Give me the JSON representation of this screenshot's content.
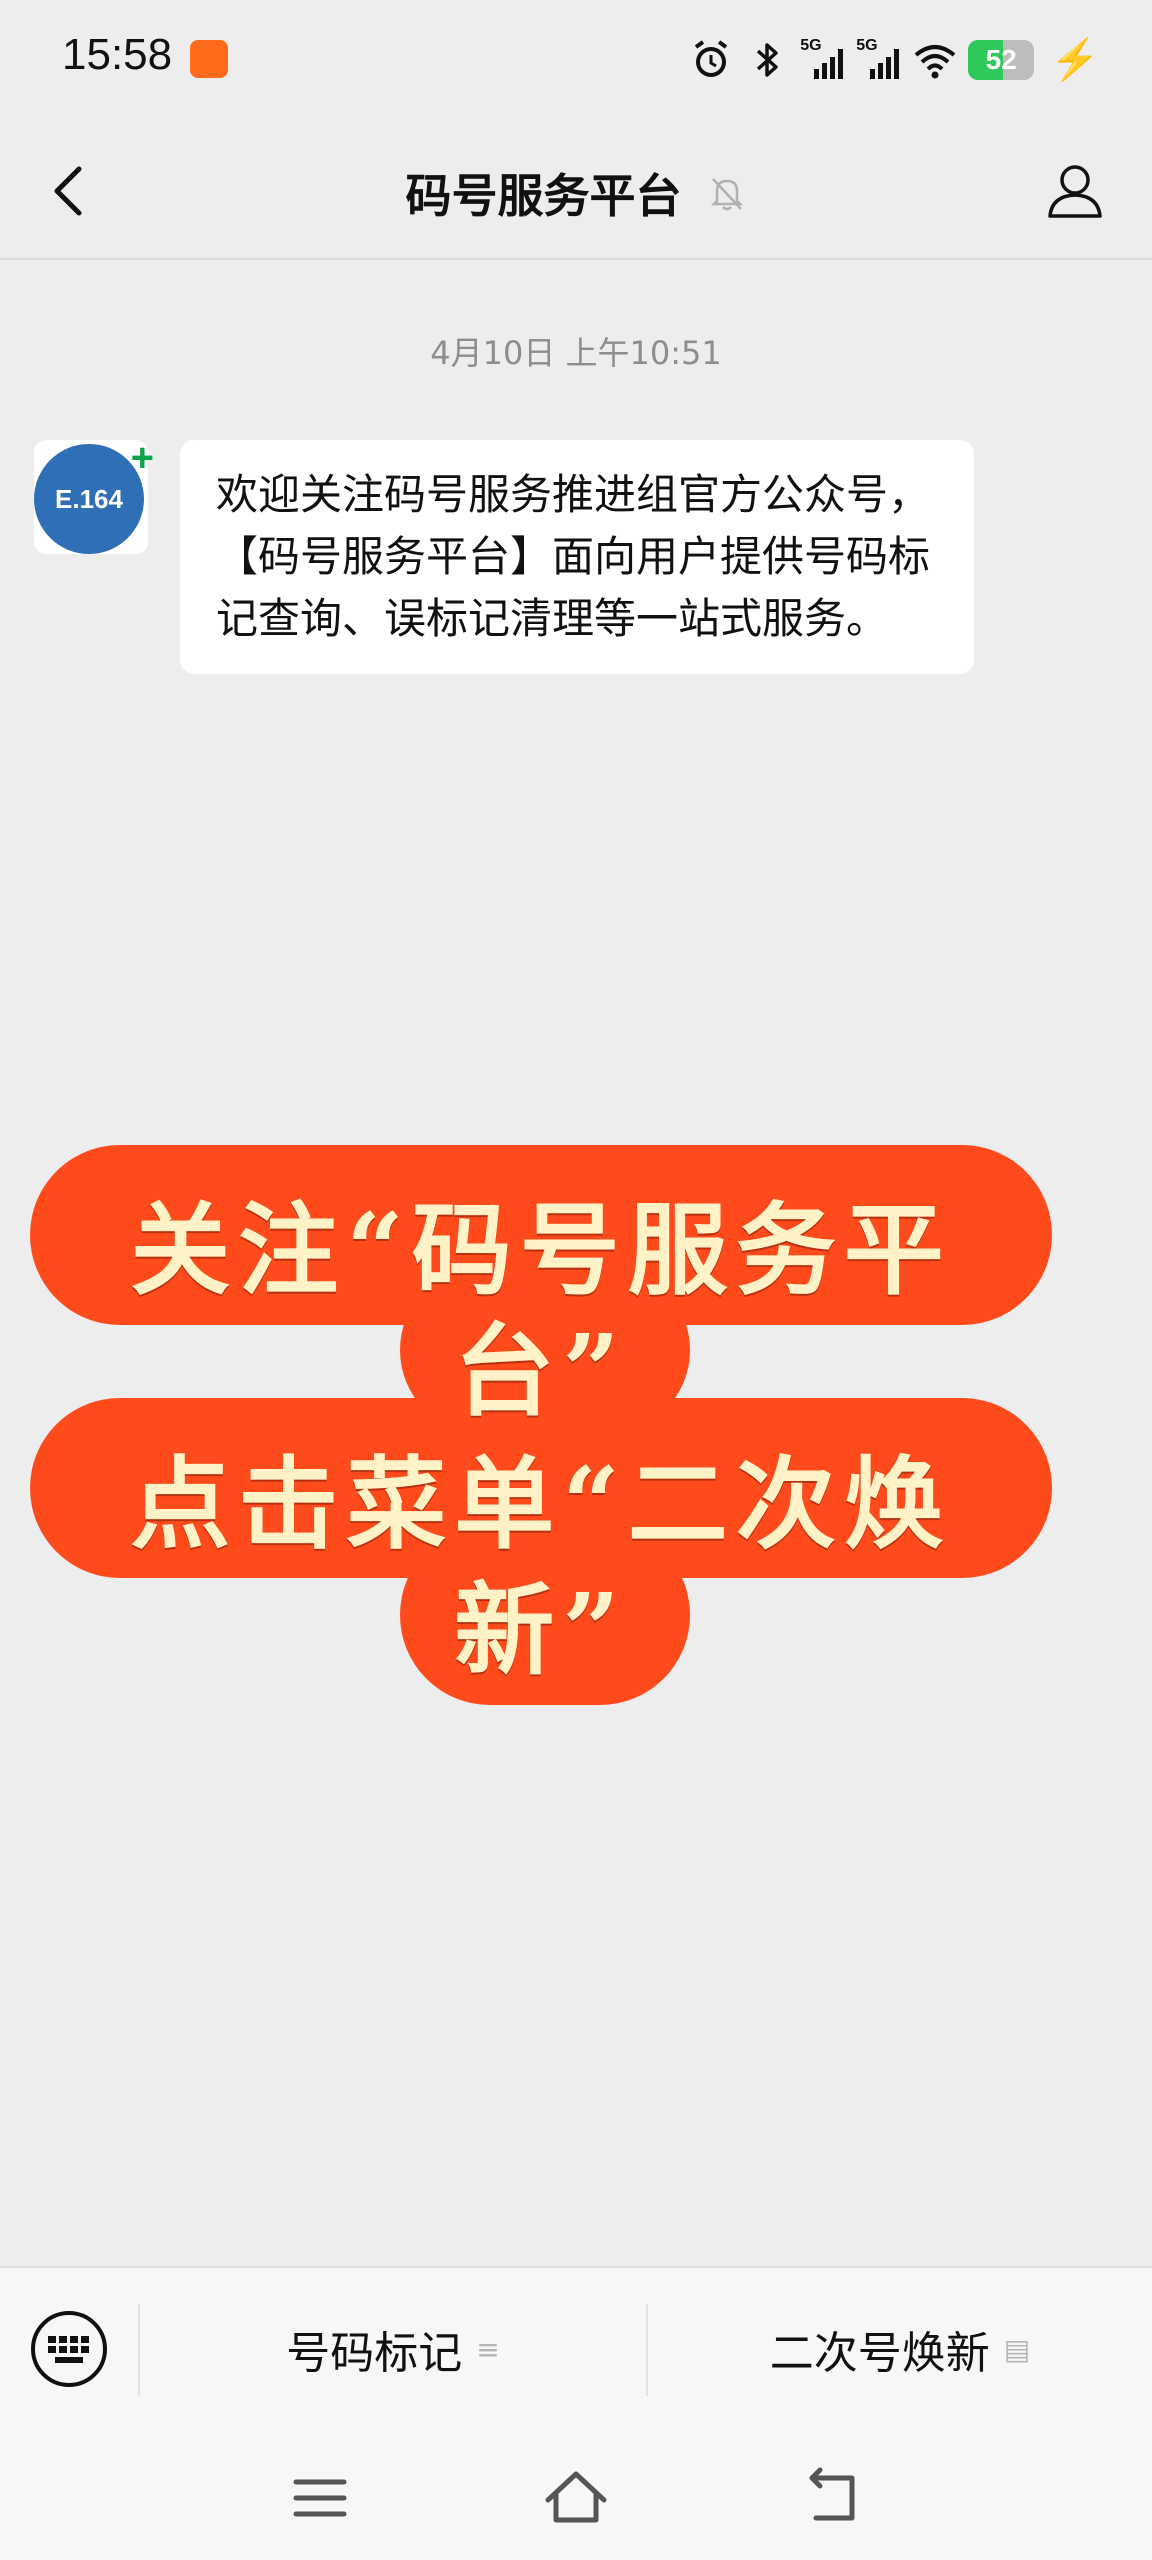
{
  "status_bar": {
    "time": "15:58",
    "icons": [
      "alarm-icon",
      "bluetooth-icon",
      "signal-5g-icon",
      "signal-5g-icon",
      "wifi-icon"
    ],
    "signal_label_1": "5G",
    "signal_label_2": "5G",
    "battery_percent": "52",
    "charging": true
  },
  "nav": {
    "title": "码号服务平台",
    "muted": true
  },
  "chat": {
    "timestamp": "4月10日 上午10:51",
    "avatar_label": "E.164",
    "message": "欢迎关注码号服务推进组官方公众号，【码号服务平台】面向用户提供号码标记查询、误标记清理等一站式服务。"
  },
  "overlay": {
    "line1": "关注“码号服务平",
    "line2": "台”",
    "line3": "点击菜单“二次焕",
    "line4": "新”",
    "colors": {
      "blob": "#ff4a1c",
      "text": "#fff2c6"
    }
  },
  "bottom_menu": {
    "items": [
      {
        "label": "号码标记",
        "suffix": "≡"
      },
      {
        "label": "二次号焕新",
        "suffix": "▤"
      }
    ]
  },
  "colors": {
    "background": "#ededed",
    "accent_green": "#2fc85a",
    "badge_orange": "#ff6b1a"
  }
}
